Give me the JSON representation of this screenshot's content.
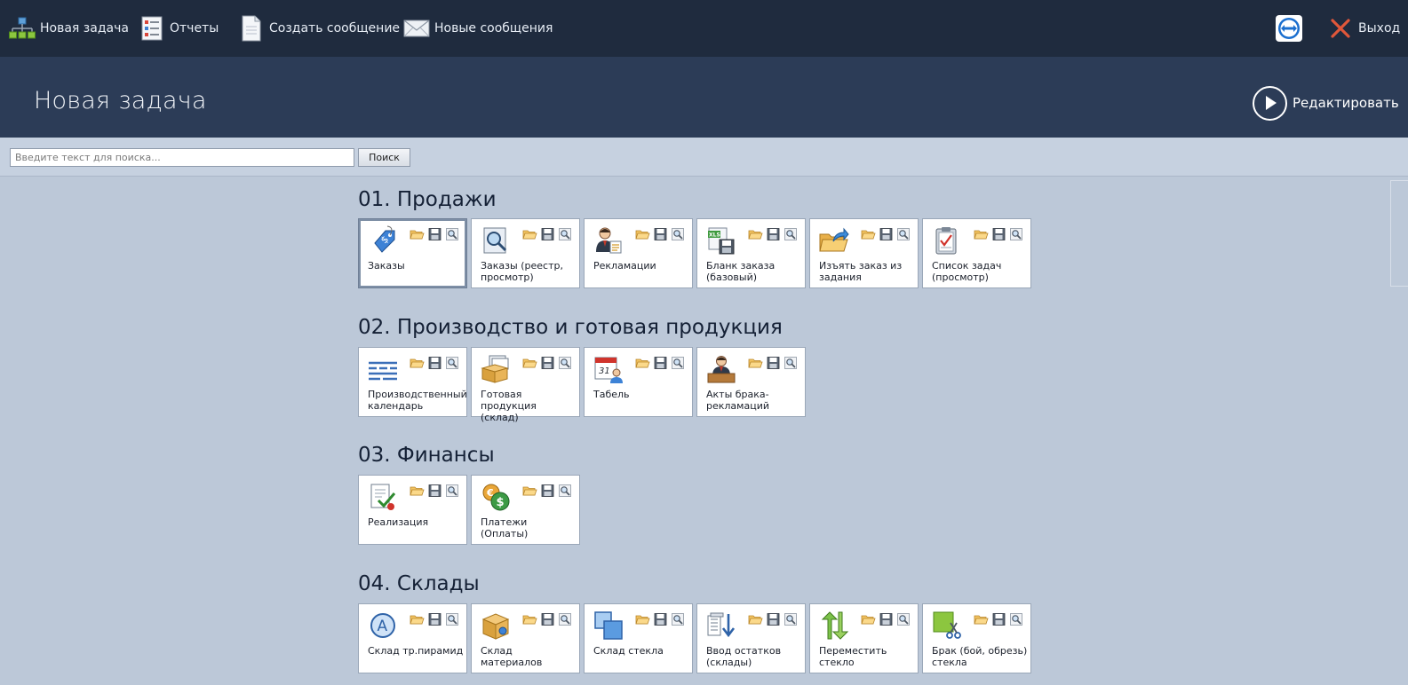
{
  "toolbar": {
    "items": [
      {
        "label": "Новая задача",
        "icon": "sitemap-icon"
      },
      {
        "label": "Отчеты",
        "icon": "report-list-icon"
      },
      {
        "label": "Создать сообщение",
        "icon": "document-icon"
      },
      {
        "label": "Новые сообщения",
        "icon": "envelope-icon"
      }
    ],
    "teamviewer_icon": "teamviewer-icon",
    "exit_label": "Выход"
  },
  "header": {
    "title": "Новая задача",
    "edit_label": "Редактировать"
  },
  "search": {
    "placeholder": "Введите текст для поиска...",
    "value": "",
    "button_label": "Поиск"
  },
  "sections": [
    {
      "title": "01. Продажи",
      "tiles": [
        {
          "label": "Заказы",
          "icon": "price-tag-icon"
        },
        {
          "label": "Заказы (реестр, просмотр)",
          "icon": "magnifier-document-icon"
        },
        {
          "label": "Рекламации",
          "icon": "person-document-icon"
        },
        {
          "label": "Бланк заказа (базовый)",
          "icon": "xls-save-icon"
        },
        {
          "label": "Изъять заказ из задания",
          "icon": "folder-export-icon"
        },
        {
          "label": "Список задач (просмотр)",
          "icon": "clipboard-check-icon"
        }
      ]
    },
    {
      "title": "02. Производство и готовая продукция",
      "tiles": [
        {
          "label": "Производственный календарь",
          "icon": "calendar-lines-icon"
        },
        {
          "label": "Готовая продукция (склад)",
          "icon": "box-cards-icon"
        },
        {
          "label": "Табель",
          "icon": "calendar-person-icon"
        },
        {
          "label": "Акты брака-рекламаций",
          "icon": "person-desk-icon"
        }
      ]
    },
    {
      "title": "03. Финансы",
      "tiles": [
        {
          "label": "Реализация",
          "icon": "document-check-icon"
        },
        {
          "label": "Платежи (Оплаты)",
          "icon": "coins-icon"
        }
      ]
    },
    {
      "title": "04. Склады",
      "tiles": [
        {
          "label": "Склад тр.пирамид",
          "icon": "letter-a-circle-icon"
        },
        {
          "label": "Склад материалов",
          "icon": "box-icon"
        },
        {
          "label": "Склад стекла",
          "icon": "glass-squares-icon"
        },
        {
          "label": "Ввод остатков (склады)",
          "icon": "stack-arrow-down-icon"
        },
        {
          "label": "Переместить стекло",
          "icon": "arrows-up-down-icon"
        },
        {
          "label": "Брак (бой, обрезь) стекла",
          "icon": "scissors-square-icon"
        }
      ]
    }
  ],
  "tile_actions": [
    {
      "icon": "open-folder-icon"
    },
    {
      "icon": "save-disk-icon"
    },
    {
      "icon": "search-preview-icon"
    }
  ],
  "colors": {
    "toolbar_bg": "#1f2b3e",
    "header_bg": "#2c3c57",
    "content_bg": "#bcc8d8",
    "exit_x": "#e0573a"
  }
}
